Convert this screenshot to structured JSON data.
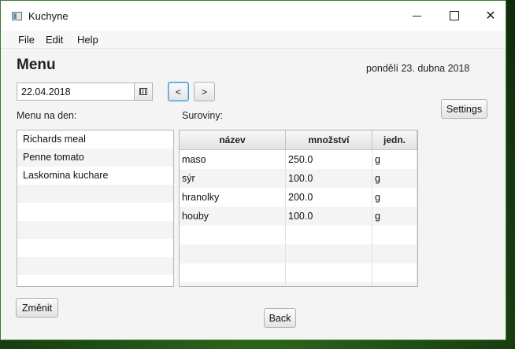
{
  "window": {
    "title": "Kuchyne",
    "minimize": "",
    "maximize": "",
    "close": "✕"
  },
  "menu": [
    "File",
    "Edit",
    "Help"
  ],
  "main": {
    "heading": "Menu",
    "date_long": "pondělí 23. dubna 2018",
    "date_value": "22.04.2018",
    "prev_label": "<",
    "next_label": ">",
    "settings_label": "Settings",
    "menu_label": "Menu na den:",
    "ingredients_label": "Suroviny:",
    "change_label": "Změnit",
    "back_label": "Back"
  },
  "menu_list": [
    "Richards meal",
    "Penne tomato",
    "Laskomina kuchare",
    "",
    "",
    "",
    "",
    "",
    ""
  ],
  "ingredients": {
    "columns": [
      "název",
      "množství",
      "jedn."
    ],
    "rows": [
      [
        "maso",
        "250.0",
        "g"
      ],
      [
        "sýr",
        "100.0",
        "g"
      ],
      [
        "hranolky",
        "200.0",
        "g"
      ],
      [
        "houby",
        "100.0",
        "g"
      ],
      [
        "",
        "",
        ""
      ],
      [
        "",
        "",
        ""
      ],
      [
        "",
        "",
        ""
      ],
      [
        "",
        "",
        ""
      ]
    ]
  }
}
